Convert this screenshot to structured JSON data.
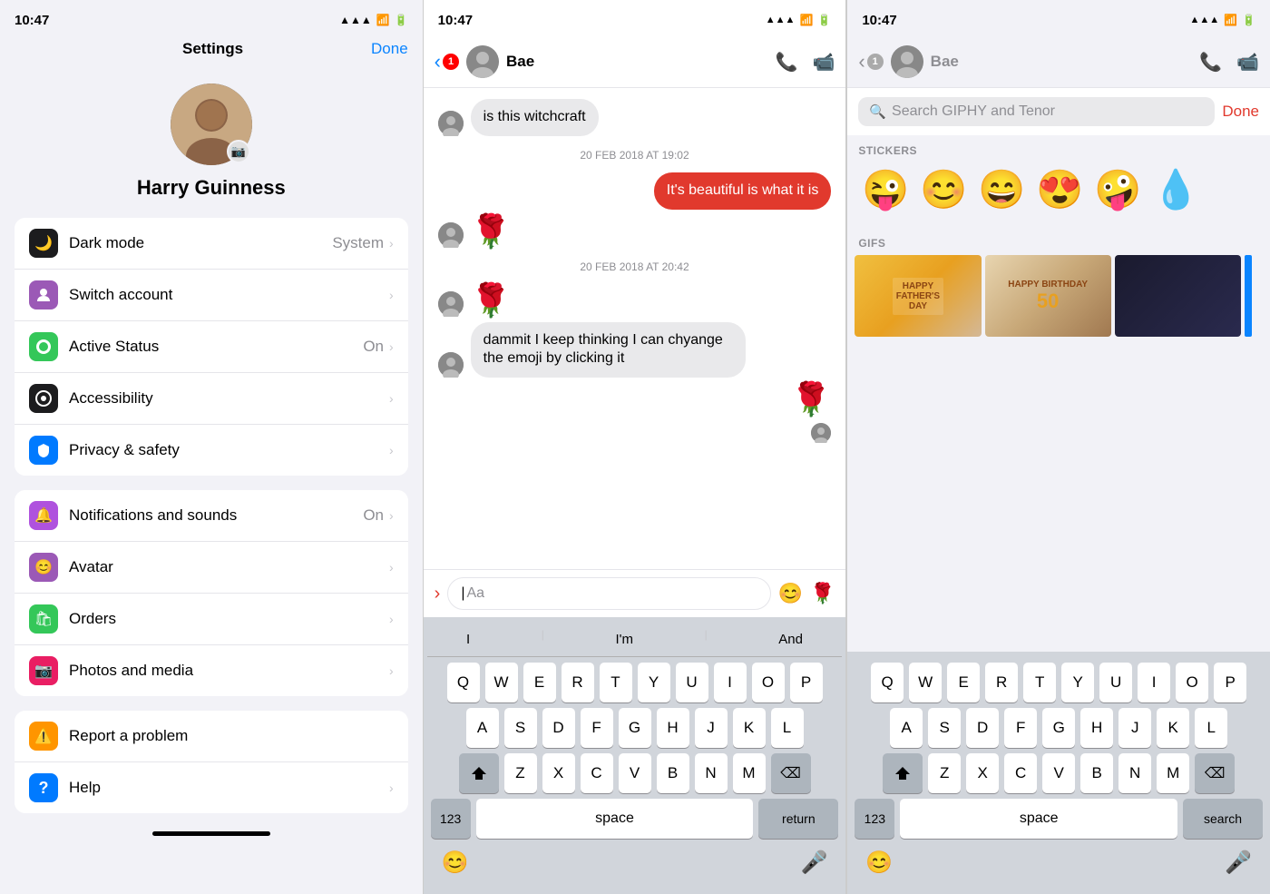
{
  "panel1": {
    "statusBar": {
      "time": "10:47",
      "batteryIcon": "🔋"
    },
    "header": {
      "title": "Settings",
      "doneLabel": "Done"
    },
    "profile": {
      "name": "Harry Guinness"
    },
    "groups": [
      {
        "items": [
          {
            "id": "dark-mode",
            "icon": "🌙",
            "iconClass": "icon-black",
            "label": "Dark mode",
            "value": "System",
            "hasChevron": true
          },
          {
            "id": "switch-account",
            "icon": "👤",
            "iconClass": "icon-purple",
            "label": "Switch account",
            "value": "",
            "hasChevron": true
          },
          {
            "id": "active-status",
            "icon": "●",
            "iconClass": "icon-green",
            "label": "Active Status",
            "value": "On",
            "hasChevron": true
          },
          {
            "id": "accessibility",
            "icon": "◉",
            "iconClass": "icon-dark",
            "label": "Accessibility",
            "value": "",
            "hasChevron": true
          },
          {
            "id": "privacy-safety",
            "icon": "🏠",
            "iconClass": "icon-blue",
            "label": "Privacy & safety",
            "value": "",
            "hasChevron": true
          }
        ]
      },
      {
        "items": [
          {
            "id": "notifications",
            "icon": "🔔",
            "iconClass": "icon-purple2",
            "label": "Notifications and sounds",
            "value": "On",
            "hasChevron": true
          },
          {
            "id": "avatar",
            "icon": "😊",
            "iconClass": "icon-purple",
            "label": "Avatar",
            "value": "",
            "hasChevron": true
          },
          {
            "id": "orders",
            "icon": "🛍",
            "iconClass": "icon-green2",
            "label": "Orders",
            "value": "",
            "hasChevron": true
          },
          {
            "id": "photos-media",
            "icon": "📷",
            "iconClass": "icon-pink",
            "label": "Photos and media",
            "value": "",
            "hasChevron": true
          }
        ]
      },
      {
        "items": [
          {
            "id": "report-problem",
            "icon": "⚠️",
            "iconClass": "icon-orange",
            "label": "Report a problem",
            "value": "",
            "hasChevron": false
          },
          {
            "id": "help",
            "icon": "?",
            "iconClass": "icon-blue2",
            "label": "Help",
            "value": "",
            "hasChevron": true
          }
        ]
      }
    ]
  },
  "panel2": {
    "statusBar": {
      "time": "10:47"
    },
    "header": {
      "backCount": "1",
      "contactName": "Bae"
    },
    "messages": [
      {
        "type": "received",
        "text": "is this witchcraft",
        "isEmoji": false
      },
      {
        "type": "timestamp",
        "text": "20 FEB 2018 AT 19:02"
      },
      {
        "type": "sent",
        "text": "It's beautiful is what it is",
        "isEmoji": false
      },
      {
        "type": "received",
        "text": "🌹",
        "isEmoji": true
      },
      {
        "type": "timestamp",
        "text": "20 FEB 2018 AT 20:42"
      },
      {
        "type": "received",
        "text": "🌹",
        "isEmoji": true
      },
      {
        "type": "received",
        "text": "dammit I keep thinking I can chyange the emoji by clicking it",
        "isEmoji": false
      },
      {
        "type": "sent",
        "text": "🌹",
        "isEmoji": true
      },
      {
        "type": "sent-avatar",
        "text": ""
      }
    ],
    "inputPlaceholder": "Aa",
    "keyboard": {
      "suggestions": [
        "I",
        "I'm",
        "And"
      ],
      "rows": [
        [
          "Q",
          "W",
          "E",
          "R",
          "T",
          "Y",
          "U",
          "I",
          "O",
          "P"
        ],
        [
          "A",
          "S",
          "D",
          "F",
          "G",
          "H",
          "J",
          "K",
          "L"
        ],
        [
          "Z",
          "X",
          "C",
          "V",
          "B",
          "N",
          "M"
        ],
        [
          "123",
          "space",
          "return"
        ]
      ]
    }
  },
  "panel3": {
    "statusBar": {
      "time": "10:47"
    },
    "header": {
      "backCount": "1",
      "contactName": "Bae"
    },
    "search": {
      "placeholder": "Search GIPHY and Tenor",
      "doneLabel": "Done"
    },
    "stickersLabel": "STICKERS",
    "stickers": [
      "😜",
      "😊",
      "😄",
      "😍",
      "🤪",
      "💧"
    ],
    "gifsLabel": "GIFS",
    "gifs": [
      {
        "id": "gif-fathers-day",
        "label": "HAPPY\nFATHER'S DAY",
        "class": "gif-1"
      },
      {
        "id": "gif-birthday",
        "label": "HAPPY BIRTHDAY 50",
        "class": "gif-2"
      },
      {
        "id": "gif-batman",
        "label": "",
        "class": "gif-3"
      }
    ],
    "keyboard": {
      "suggestions": [],
      "rows": [
        [
          "Q",
          "W",
          "E",
          "R",
          "T",
          "Y",
          "U",
          "I",
          "O",
          "P"
        ],
        [
          "A",
          "S",
          "D",
          "F",
          "G",
          "H",
          "J",
          "K",
          "L"
        ],
        [
          "Z",
          "X",
          "C",
          "V",
          "B",
          "N",
          "M"
        ],
        [
          "123",
          "space",
          "search"
        ]
      ]
    },
    "bottomIcons": [
      "emoji",
      "mic"
    ]
  }
}
